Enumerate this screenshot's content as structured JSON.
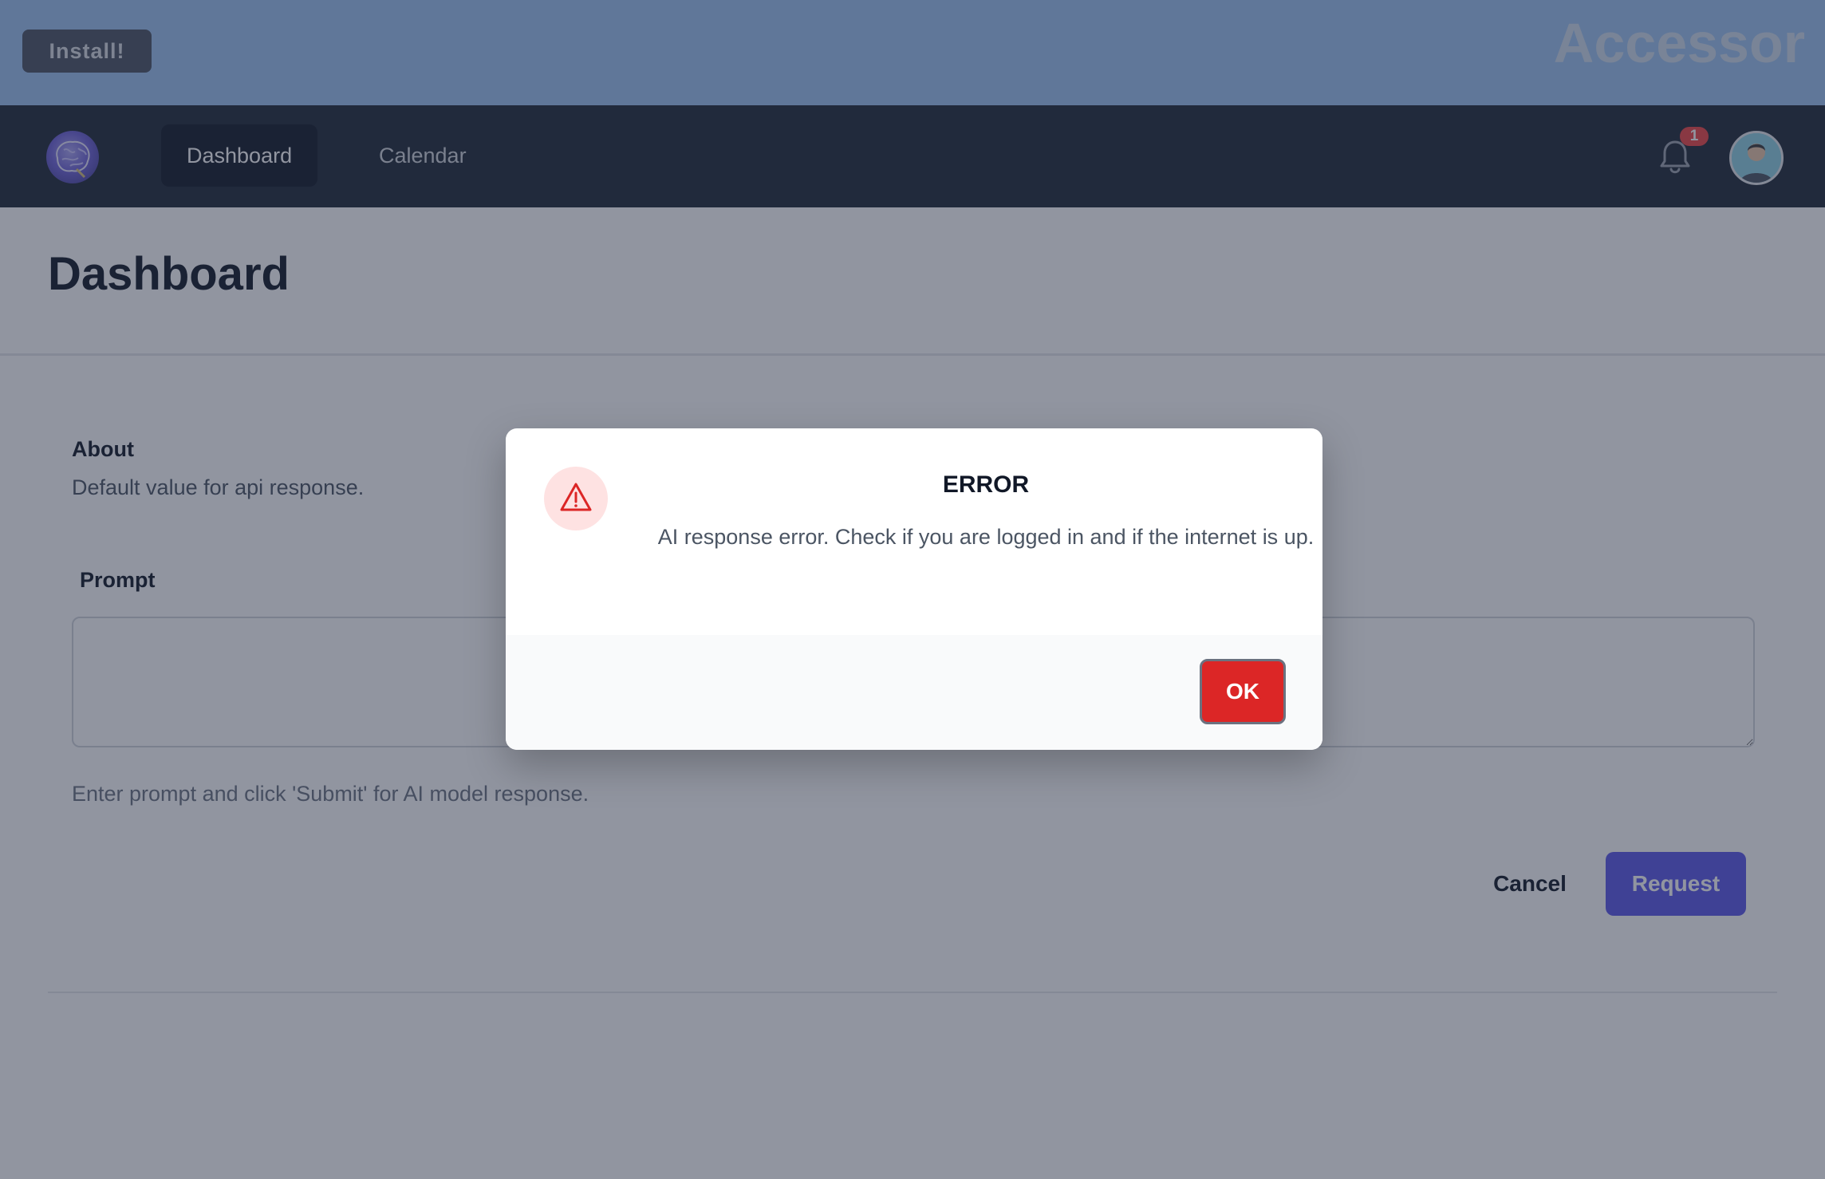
{
  "topbar": {
    "install_label": "Install!",
    "brand": "Accessor"
  },
  "nav": {
    "items": [
      {
        "label": "Dashboard",
        "active": true
      },
      {
        "label": "Calendar",
        "active": false
      }
    ],
    "notification_count": "1"
  },
  "page": {
    "title": "Dashboard",
    "about_title": "About",
    "about_desc": "Default value for api response.",
    "prompt_label": "Prompt",
    "prompt_value": "",
    "prompt_help": "Enter prompt and click 'Submit' for AI model response.",
    "cancel_label": "Cancel",
    "request_label": "Request"
  },
  "modal": {
    "title": "ERROR",
    "message": "AI response error. Check if you are logged in and if the internet is up.",
    "ok_label": "OK",
    "icon": "warning-triangle-icon"
  },
  "colors": {
    "accent": "#5b57e8",
    "danger": "#dc2626",
    "nav_bg": "#1f2937",
    "topbar_bg": "#9dc3f0"
  }
}
